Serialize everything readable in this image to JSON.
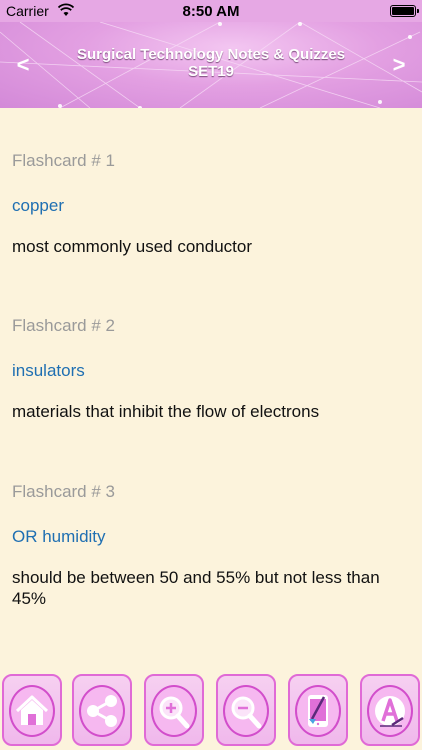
{
  "status_bar": {
    "carrier": "Carrier",
    "time": "8:50 AM"
  },
  "header": {
    "title_line1": "Surgical Technology Notes & Quizzes",
    "title_line2": "SET19",
    "prev_glyph": "<",
    "next_glyph": ">"
  },
  "flashcards": [
    {
      "number": "Flashcard # 1",
      "term": "copper",
      "definition": "most commonly used conductor"
    },
    {
      "number": "Flashcard # 2",
      "term": "insulators",
      "definition": "materials that inhibit the flow of electrons"
    },
    {
      "number": "Flashcard # 3",
      "term": "OR humidity",
      "definition": "should be between 50 and 55% but not less than 45%"
    }
  ],
  "toolbar": {
    "icons": [
      "home-icon",
      "share-icon",
      "zoom-in-icon",
      "zoom-out-icon",
      "phone-clean-icon",
      "font-style-icon"
    ]
  },
  "colors": {
    "header": "#e3a0e2",
    "background": "#fcf3dc",
    "term": "#1f6fb2",
    "card_number": "#9a9a9a",
    "toolbar_accent": "#e06ad6"
  }
}
